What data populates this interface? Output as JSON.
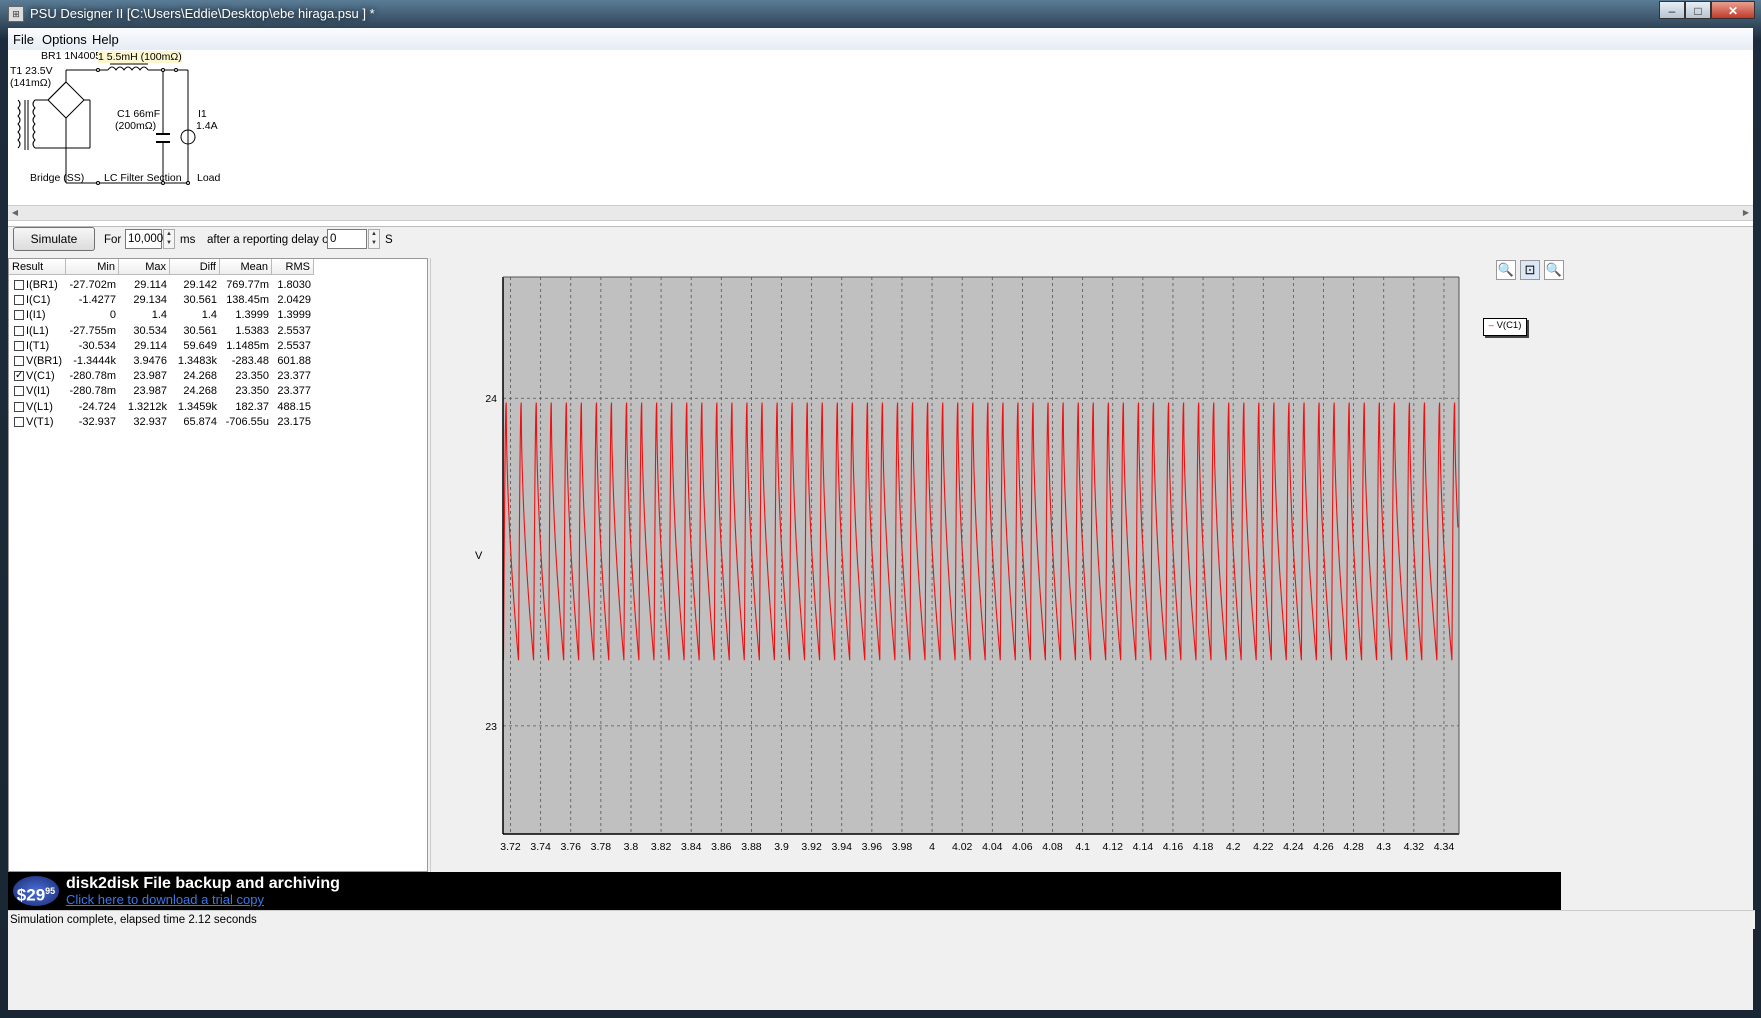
{
  "window": {
    "title": "PSU Designer II  [C:\\Users\\Eddie\\Desktop\\ebe hiraga.psu ] *",
    "min": "–",
    "max": "□",
    "close": "✕"
  },
  "menu": [
    "File",
    "Options",
    "Help"
  ],
  "schematic": {
    "bridge_label": "BR1 1N4005",
    "inductor_label": "1 5.5mH (100mΩ)",
    "transformer_label1": "T1 23.5V",
    "transformer_label2": "(141mΩ)",
    "cap_label1": "C1 66mF",
    "cap_label2": "(200mΩ)",
    "load_label1": "I1",
    "load_label2": "1.4A",
    "section_bridge": "Bridge (SS)",
    "section_filter": "LC Filter Section",
    "section_load": "Load"
  },
  "toolbar": {
    "simulate": "Simulate",
    "for_label": "For",
    "duration": "10,000",
    "ms_label": "ms",
    "delay_label": "after a reporting delay of",
    "delay": "0",
    "s_label": "S"
  },
  "results": {
    "headers": [
      "Result",
      "Min",
      "Max",
      "Diff",
      "Mean",
      "RMS"
    ],
    "rows": [
      {
        "checked": false,
        "name": "I(BR1)",
        "min": "-27.702m",
        "max": "29.114",
        "diff": "29.142",
        "mean": "769.77m",
        "rms": "1.8030"
      },
      {
        "checked": false,
        "name": "I(C1)",
        "min": "-1.4277",
        "max": "29.134",
        "diff": "30.561",
        "mean": "138.45m",
        "rms": "2.0429"
      },
      {
        "checked": false,
        "name": "I(I1)",
        "min": "0",
        "max": "1.4",
        "diff": "1.4",
        "mean": "1.3999",
        "rms": "1.3999"
      },
      {
        "checked": false,
        "name": "I(L1)",
        "min": "-27.755m",
        "max": "30.534",
        "diff": "30.561",
        "mean": "1.5383",
        "rms": "2.5537"
      },
      {
        "checked": false,
        "name": "I(T1)",
        "min": "-30.534",
        "max": "29.114",
        "diff": "59.649",
        "mean": "1.1485m",
        "rms": "2.5537"
      },
      {
        "checked": false,
        "name": "V(BR1)",
        "min": "-1.3444k",
        "max": "3.9476",
        "diff": "1.3483k",
        "mean": "-283.48",
        "rms": "601.88"
      },
      {
        "checked": true,
        "name": "V(C1)",
        "min": "-280.78m",
        "max": "23.987",
        "diff": "24.268",
        "mean": "23.350",
        "rms": "23.377"
      },
      {
        "checked": false,
        "name": "V(I1)",
        "min": "-280.78m",
        "max": "23.987",
        "diff": "24.268",
        "mean": "23.350",
        "rms": "23.377"
      },
      {
        "checked": false,
        "name": "V(L1)",
        "min": "-24.724",
        "max": "1.3212k",
        "diff": "1.3459k",
        "mean": "182.37",
        "rms": "488.15"
      },
      {
        "checked": false,
        "name": "V(T1)",
        "min": "-32.937",
        "max": "32.937",
        "diff": "65.874",
        "mean": "-706.55u",
        "rms": "23.175"
      }
    ]
  },
  "chart_data": {
    "type": "line",
    "ylabel": "V",
    "xlim": [
      3.715,
      4.35
    ],
    "ylim": [
      22.67,
      24.37
    ],
    "y_ticks": [
      "23",
      "24"
    ],
    "x_ticks": [
      "3.72",
      "3.74",
      "3.76",
      "3.78",
      "3.8",
      "3.82",
      "3.84",
      "3.86",
      "3.88",
      "3.9",
      "3.92",
      "3.94",
      "3.96",
      "3.98",
      "4",
      "4.02",
      "4.04",
      "4.06",
      "4.08",
      "4.1",
      "4.12",
      "4.14",
      "4.16",
      "4.18",
      "4.2",
      "4.22",
      "4.24",
      "4.26",
      "4.28",
      "4.3",
      "4.32",
      "4.34"
    ],
    "series": [
      {
        "name": "V(C1)",
        "color": "#ee1111",
        "period": 0.01,
        "max": 23.987,
        "min": 23.2
      }
    ],
    "grid": true,
    "legend": "top-right"
  },
  "ad": {
    "price": "$29",
    "price_cents": "95",
    "title": "disk2disk File backup and archiving",
    "link": "Click here to download a trial copy"
  },
  "status": "Simulation complete, elapsed time 2.12 seconds"
}
